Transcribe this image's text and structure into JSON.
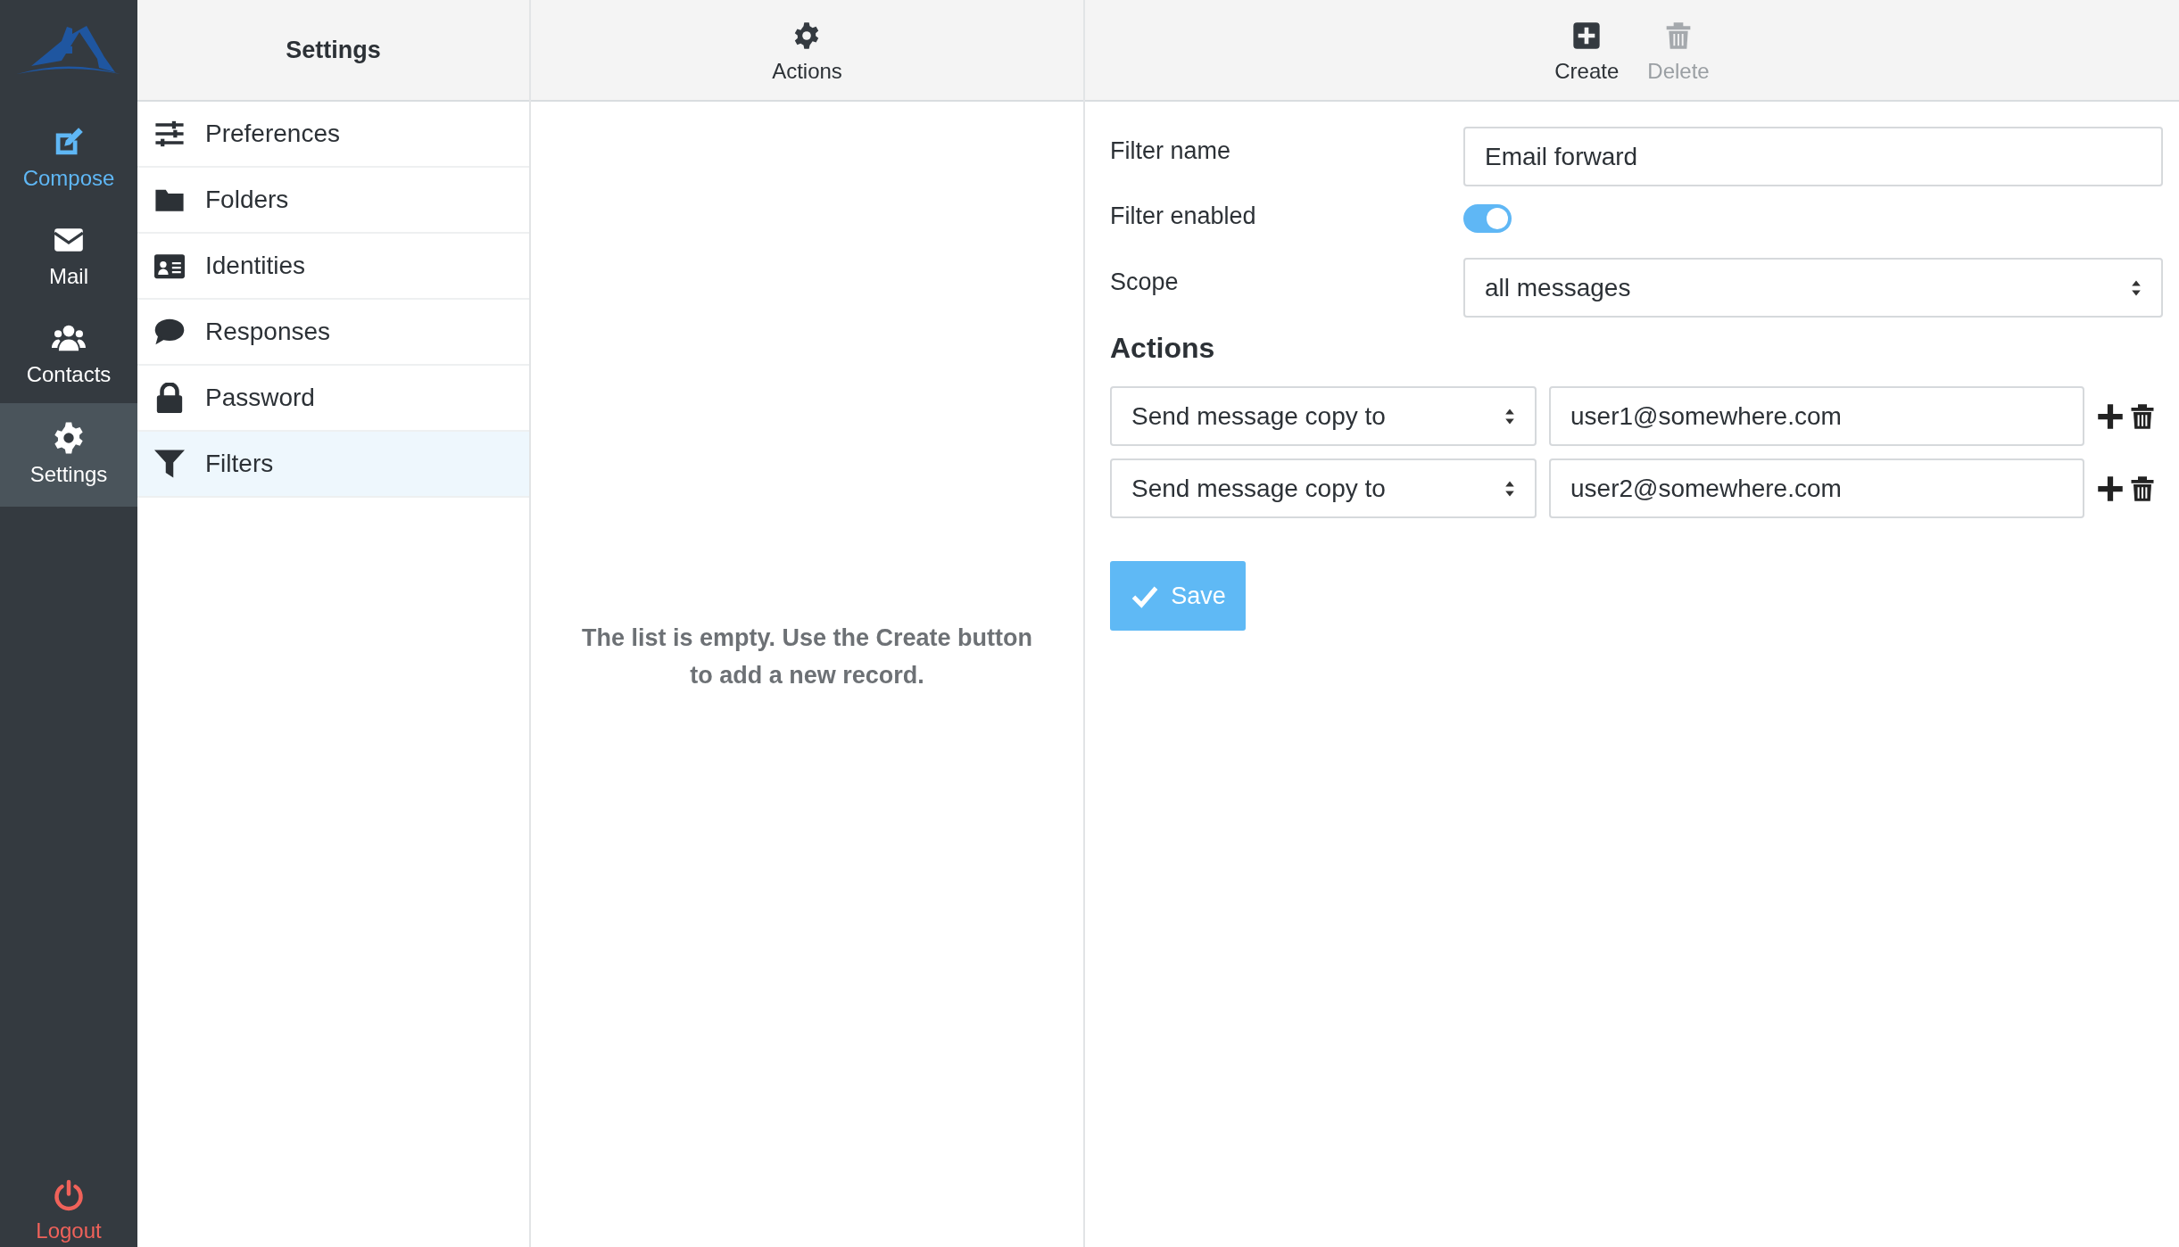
{
  "nav": {
    "items": [
      {
        "label": "Compose",
        "kind": "compose",
        "selected": false
      },
      {
        "label": "Mail",
        "kind": "link",
        "selected": false
      },
      {
        "label": "Contacts",
        "kind": "link",
        "selected": false
      },
      {
        "label": "Settings",
        "kind": "link",
        "selected": true
      }
    ],
    "logout": {
      "label": "Logout"
    }
  },
  "settings": {
    "title": "Settings",
    "items": [
      {
        "label": "Preferences",
        "selected": false
      },
      {
        "label": "Folders",
        "selected": false
      },
      {
        "label": "Identities",
        "selected": false
      },
      {
        "label": "Responses",
        "selected": false
      },
      {
        "label": "Password",
        "selected": false
      },
      {
        "label": "Filters",
        "selected": true
      }
    ]
  },
  "list": {
    "toolbar": [
      {
        "label": "Actions",
        "disabled": false
      }
    ],
    "empty_message": "The list is empty. Use the Create button to add a new record."
  },
  "form": {
    "toolbar": [
      {
        "label": "Create",
        "disabled": false
      },
      {
        "label": "Delete",
        "disabled": true
      }
    ],
    "filter_name": {
      "label": "Filter name",
      "value": "Email forward"
    },
    "filter_enabled": {
      "label": "Filter enabled",
      "on": true
    },
    "scope": {
      "label": "Scope",
      "value": "all messages"
    },
    "actions_heading": "Actions",
    "actions": [
      {
        "type": "Send message copy to",
        "target": "user1@somewhere.com"
      },
      {
        "type": "Send message copy to",
        "target": "user2@somewhere.com"
      }
    ],
    "save": "Save"
  }
}
